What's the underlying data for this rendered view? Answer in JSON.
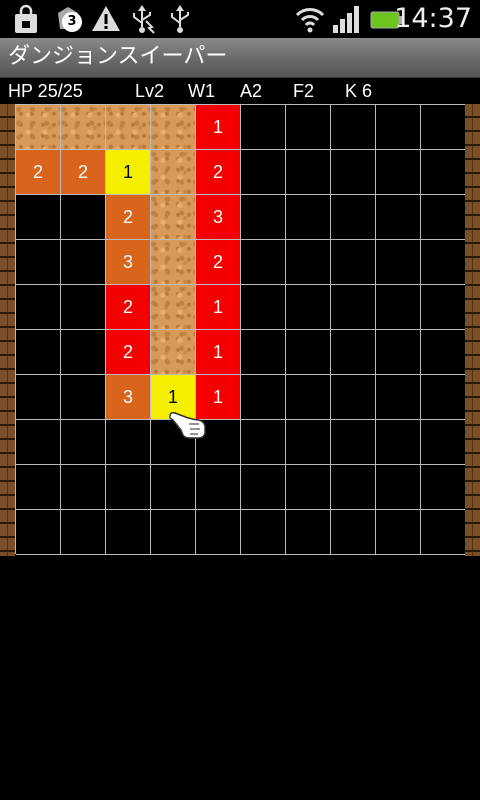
{
  "status_bar": {
    "time": "14:37",
    "notification_count": "3",
    "icons": [
      "shopping-bag-icon",
      "notification-badge-icon",
      "warning-icon",
      "usb-debug-icon",
      "usb-icon",
      "wifi-icon",
      "signal-icon",
      "battery-icon"
    ]
  },
  "app": {
    "title": "ダンジョンスイーパー"
  },
  "stats": {
    "hp": "HP 25/25",
    "level": "Lv2",
    "weapon": "W1",
    "armor": "A2",
    "floor": "F2",
    "keys": "K 6"
  },
  "board": {
    "cols": 10,
    "rows": 10,
    "legend": {
      "H": "hidden",
      "F": "floor",
      "O": "orange",
      "R": "red",
      "Y": "yellow"
    },
    "tiles": [
      [
        "F",
        "F",
        "F",
        "F",
        "R",
        "H",
        "H",
        "H",
        "H",
        "H"
      ],
      [
        "O",
        "O",
        "Y",
        "F",
        "R",
        "H",
        "H",
        "H",
        "H",
        "H"
      ],
      [
        "H",
        "H",
        "O",
        "F",
        "R",
        "H",
        "H",
        "H",
        "H",
        "H"
      ],
      [
        "H",
        "H",
        "O",
        "F",
        "R",
        "H",
        "H",
        "H",
        "H",
        "H"
      ],
      [
        "H",
        "H",
        "R",
        "F",
        "R",
        "H",
        "H",
        "H",
        "H",
        "H"
      ],
      [
        "H",
        "H",
        "R",
        "F",
        "R",
        "H",
        "H",
        "H",
        "H",
        "H"
      ],
      [
        "H",
        "H",
        "O",
        "Y",
        "R",
        "H",
        "H",
        "H",
        "H",
        "H"
      ],
      [
        "H",
        "H",
        "H",
        "H",
        "H",
        "H",
        "H",
        "H",
        "H",
        "H"
      ],
      [
        "H",
        "H",
        "H",
        "H",
        "H",
        "H",
        "H",
        "H",
        "H",
        "H"
      ],
      [
        "H",
        "H",
        "H",
        "H",
        "H",
        "H",
        "H",
        "H",
        "H",
        "H"
      ]
    ],
    "numbers": [
      [
        "",
        "",
        "",
        "",
        "1",
        "",
        "",
        "",
        "",
        ""
      ],
      [
        "2",
        "2",
        "1",
        "",
        "2",
        "",
        "",
        "",
        "",
        ""
      ],
      [
        "",
        "",
        "2",
        "",
        "3",
        "",
        "",
        "",
        "",
        ""
      ],
      [
        "",
        "",
        "3",
        "",
        "2",
        "",
        "",
        "",
        "",
        ""
      ],
      [
        "",
        "",
        "2",
        "",
        "1",
        "",
        "",
        "",
        "",
        ""
      ],
      [
        "",
        "",
        "2",
        "",
        "1",
        "",
        "",
        "",
        "",
        ""
      ],
      [
        "",
        "",
        "3",
        "1",
        "1",
        "",
        "",
        "",
        "",
        ""
      ],
      [
        "",
        "",
        "",
        "",
        "",
        "",
        "",
        "",
        "",
        ""
      ],
      [
        "",
        "",
        "",
        "",
        "",
        "",
        "",
        "",
        "",
        ""
      ],
      [
        "",
        "",
        "",
        "",
        "",
        "",
        "",
        "",
        "",
        ""
      ]
    ],
    "cursor": {
      "row": 4,
      "col": 3,
      "icon": "pointing-hand-icon"
    }
  }
}
